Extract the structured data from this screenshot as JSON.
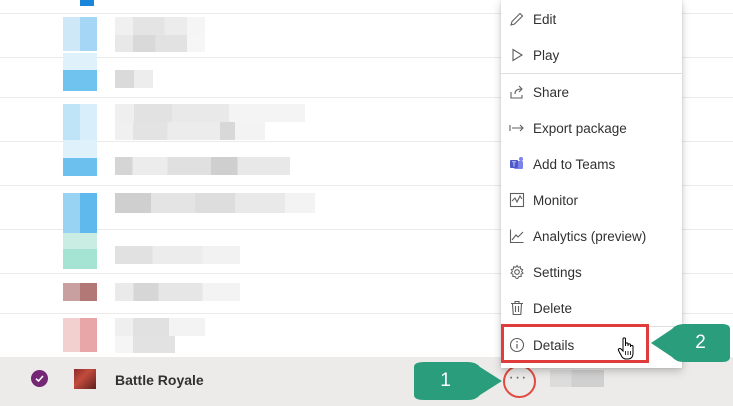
{
  "menu": {
    "items": [
      {
        "label": "Edit",
        "icon": "pencil-icon"
      },
      {
        "label": "Play",
        "icon": "play-icon"
      },
      {
        "label": "Share",
        "icon": "share-icon"
      },
      {
        "label": "Export package",
        "icon": "export-arrow-icon"
      },
      {
        "label": "Add to Teams",
        "icon": "teams-icon"
      },
      {
        "label": "Monitor",
        "icon": "monitor-icon"
      },
      {
        "label": "Analytics (preview)",
        "icon": "analytics-chart-icon"
      },
      {
        "label": "Settings",
        "icon": "gear-icon"
      },
      {
        "label": "Delete",
        "icon": "trash-icon"
      },
      {
        "label": "Details",
        "icon": "info-icon"
      }
    ]
  },
  "selected_row": {
    "name": "Battle Royale",
    "more_label": "···"
  },
  "callouts": {
    "one": "1",
    "two": "2"
  },
  "colors": {
    "accent": "#742774",
    "highlight": "#e03c3c",
    "callout": "#2a9d7c",
    "selected_bg": "#edebe9"
  }
}
